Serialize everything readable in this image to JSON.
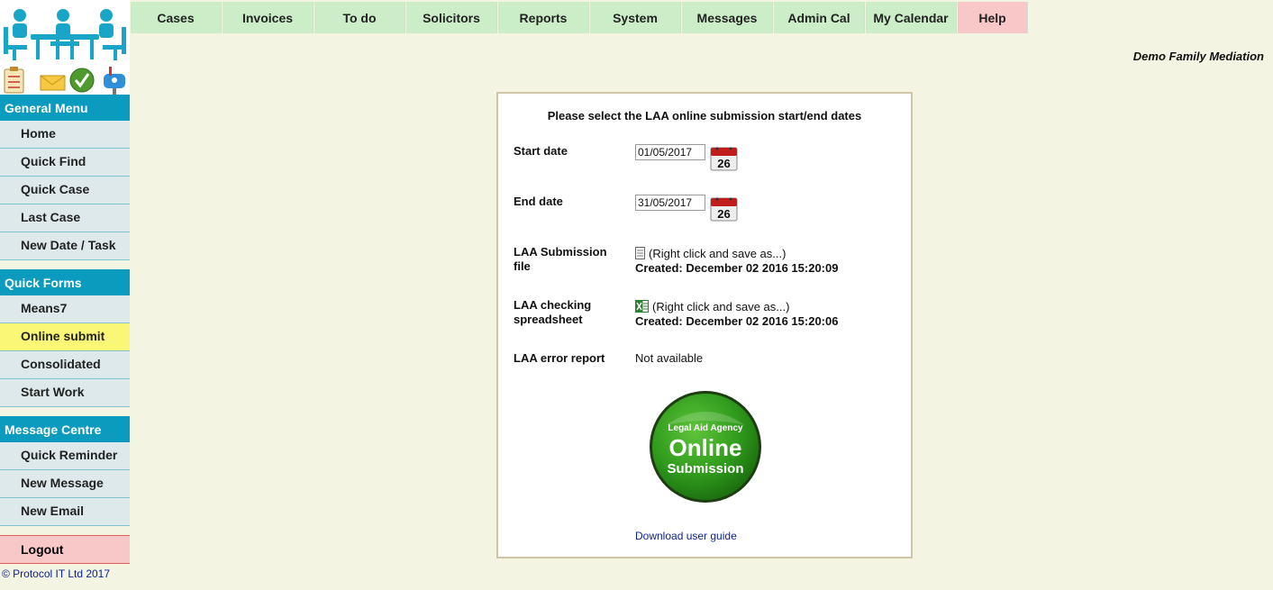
{
  "nav": {
    "tabs": [
      {
        "label": "Cases"
      },
      {
        "label": "Invoices"
      },
      {
        "label": "To do"
      },
      {
        "label": "Solicitors"
      },
      {
        "label": "Reports"
      },
      {
        "label": "System"
      },
      {
        "label": "Messages"
      },
      {
        "label": "Admin Cal"
      },
      {
        "label": "My Calendar"
      },
      {
        "label": "Help"
      }
    ]
  },
  "company_name": "Demo Family Mediation",
  "sidebar": {
    "general_title": "General Menu",
    "general_items": [
      {
        "label": "Home"
      },
      {
        "label": "Quick Find"
      },
      {
        "label": "Quick Case"
      },
      {
        "label": "Last Case"
      },
      {
        "label": "New Date / Task"
      }
    ],
    "forms_title": "Quick Forms",
    "forms_items": [
      {
        "label": "Means7"
      },
      {
        "label": "Online submit"
      },
      {
        "label": "Consolidated"
      },
      {
        "label": "Start Work"
      }
    ],
    "messages_title": "Message Centre",
    "messages_items": [
      {
        "label": "Quick Reminder"
      },
      {
        "label": "New Message"
      },
      {
        "label": "New Email"
      }
    ],
    "logout": "Logout"
  },
  "copyright": "© Protocol IT Ltd 2017",
  "panel": {
    "title": "Please select the LAA online submission start/end dates",
    "start_label": "Start date",
    "start_value": "01/05/2017",
    "end_label": "End date",
    "end_value": "31/05/2017",
    "calendar_day": "26",
    "submission_label_1": "LAA Submission",
    "submission_label_2": "file",
    "submission_hint": "(Right click and save as...)",
    "submission_created": "Created: December 02 2016 15:20:09",
    "checking_label_1": "LAA checking",
    "checking_label_2": "spreadsheet",
    "checking_hint": "(Right click and save as...)",
    "checking_created": "Created: December 02 2016 15:20:06",
    "error_label": "LAA error report",
    "error_value": "Not available",
    "badge_line1": "Legal Aid Agency",
    "badge_line2": "Online",
    "badge_line3": "Submission",
    "guide_link": "Download user guide"
  }
}
